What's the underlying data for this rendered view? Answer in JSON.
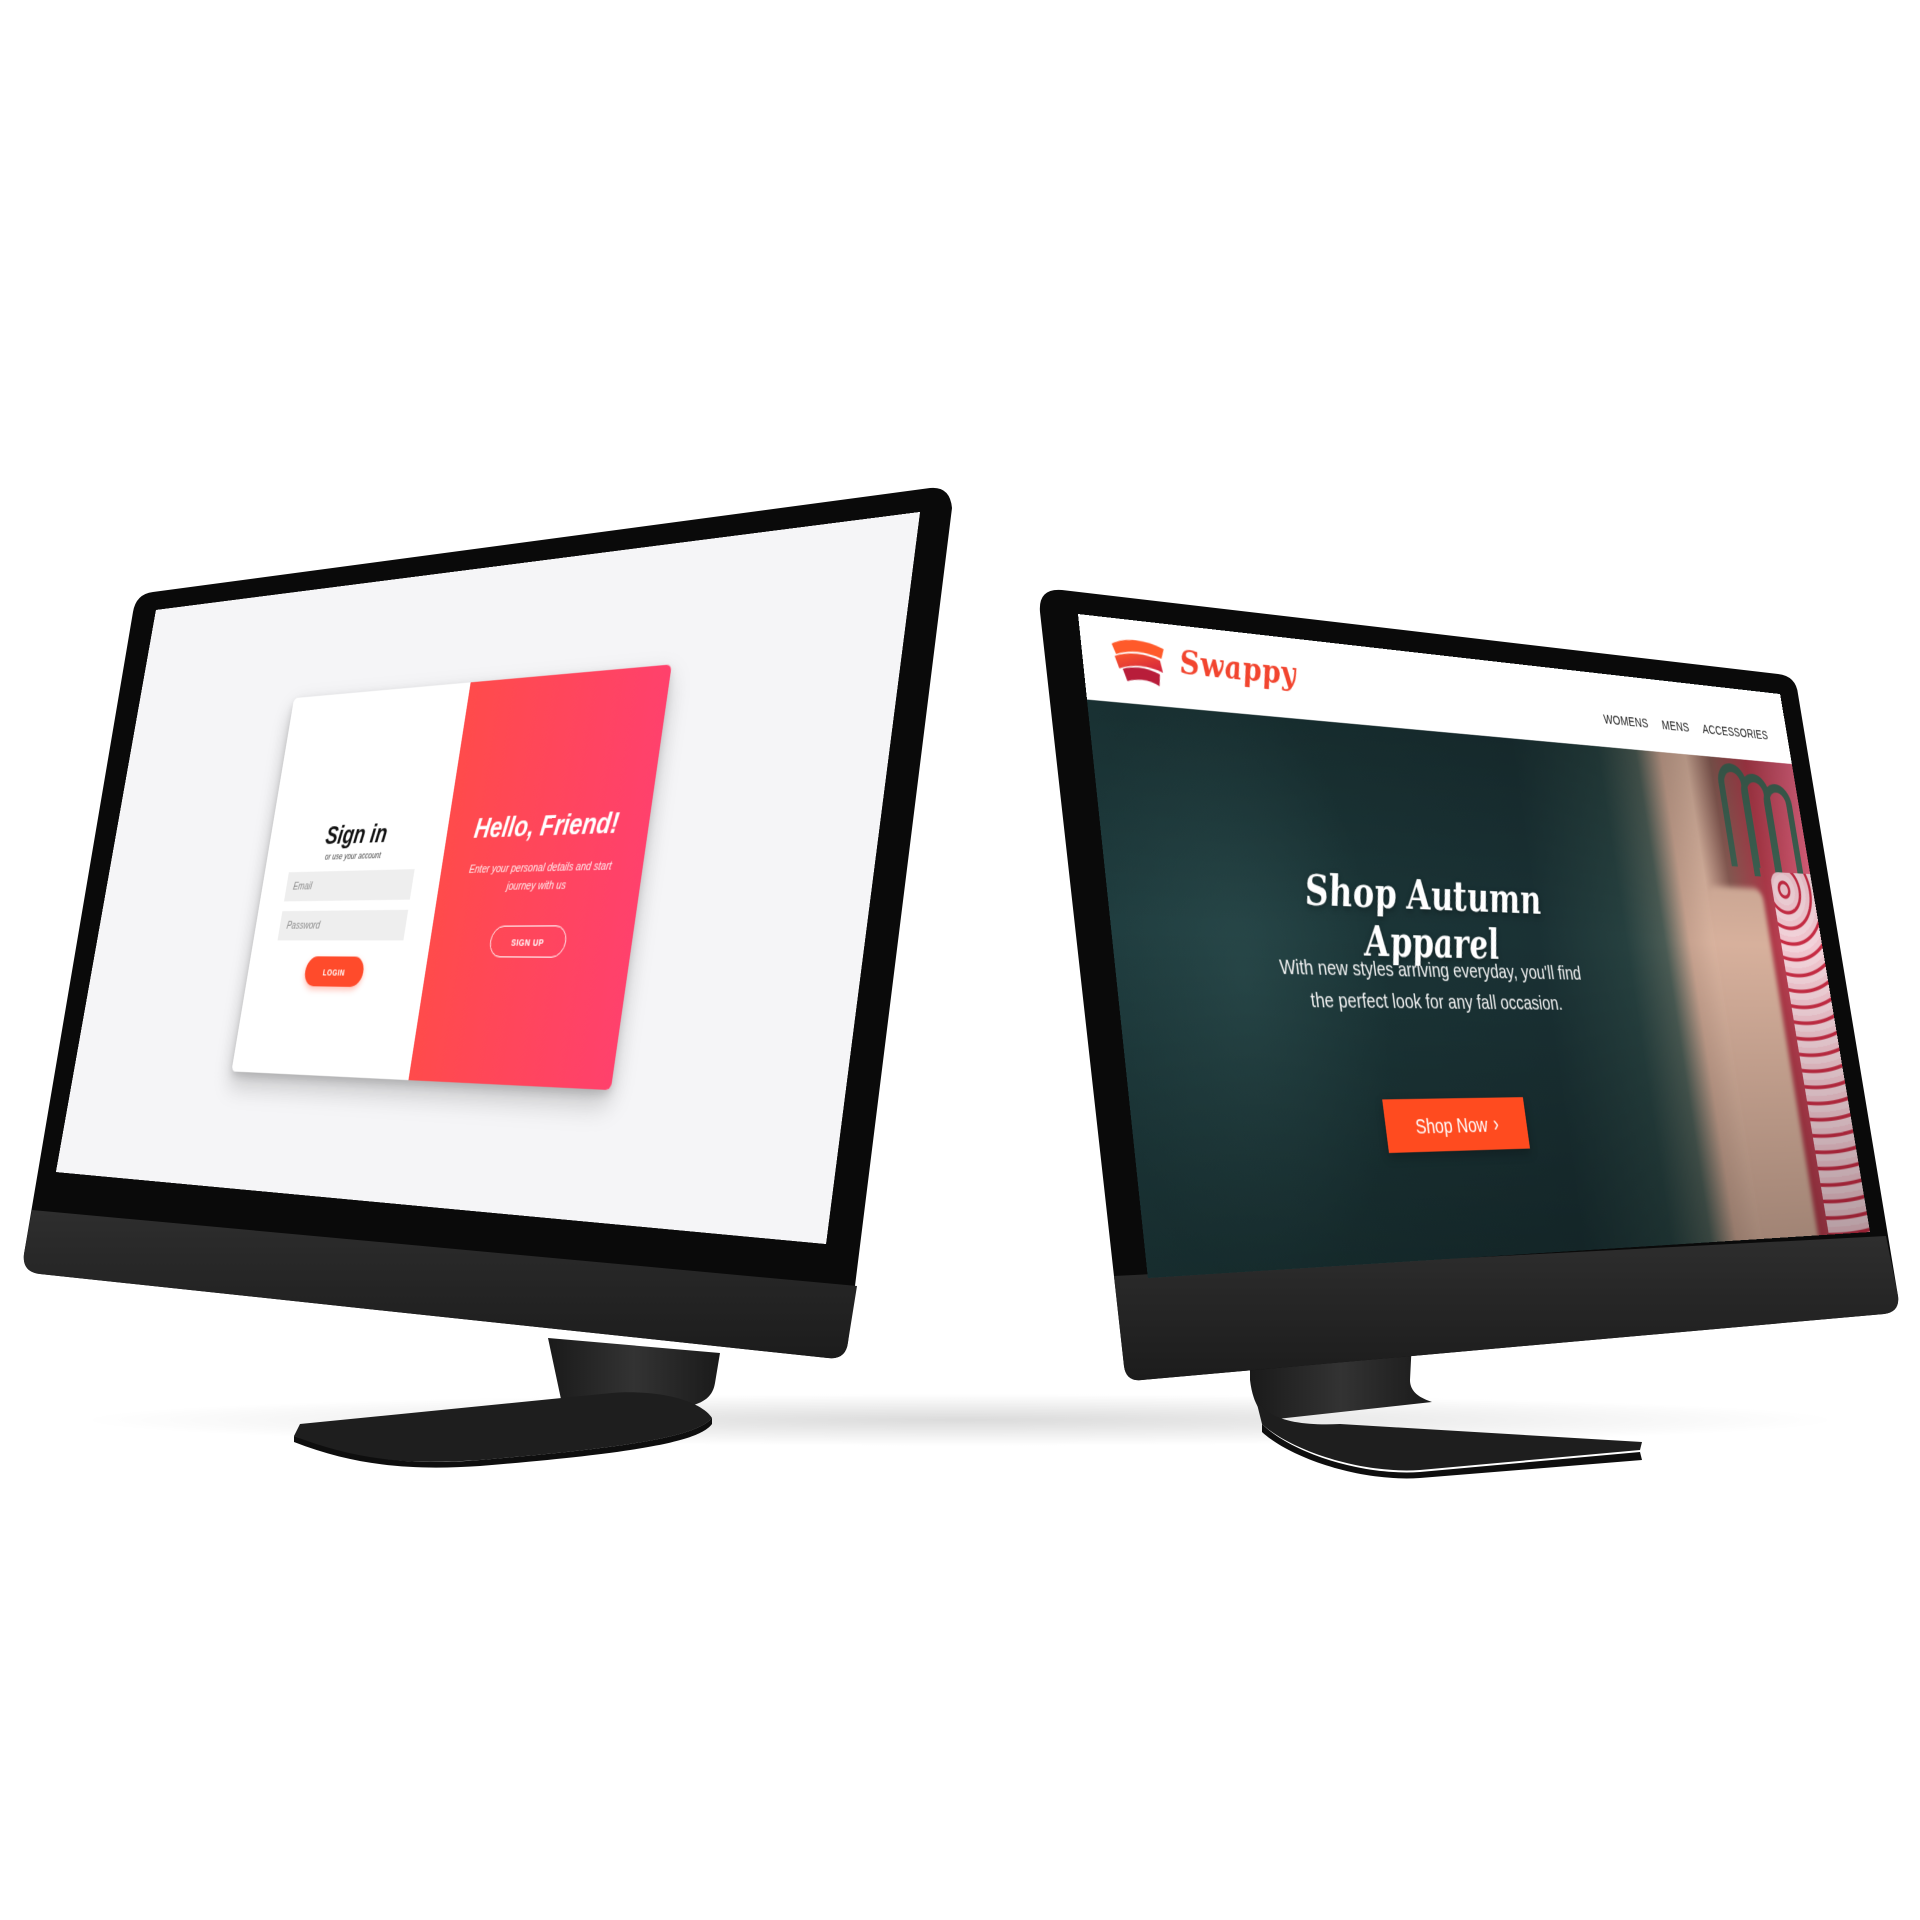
{
  "left_screen": {
    "signin": {
      "title": "Sign in",
      "subtitle": "or use your account",
      "email_placeholder": "Email",
      "password_placeholder": "Password",
      "login_label": "LOGIN"
    },
    "welcome": {
      "title": "Hello, Friend!",
      "text": "Enter your personal details and start journey with us",
      "signup_label": "SIGN UP"
    },
    "colors": {
      "accent_start": "#ff4b4b",
      "accent_end": "#ff416c",
      "login_button": "#ff4b2b"
    }
  },
  "right_screen": {
    "brand": {
      "name": "Swappy",
      "logo_icon": "stadia-style-logo-icon",
      "color": "#f2452f"
    },
    "nav": {
      "items": [
        "WOMENS",
        "MENS",
        "ACCESSORIES"
      ]
    },
    "hero": {
      "title": "Shop Autumn Apparel",
      "text": "With new styles arriving everyday, you'll find the perfect look for any fall occasion.",
      "cta_label": "Shop Now",
      "cta_icon": "chevron-right-icon",
      "cta_color": "#ff4b1f"
    }
  }
}
